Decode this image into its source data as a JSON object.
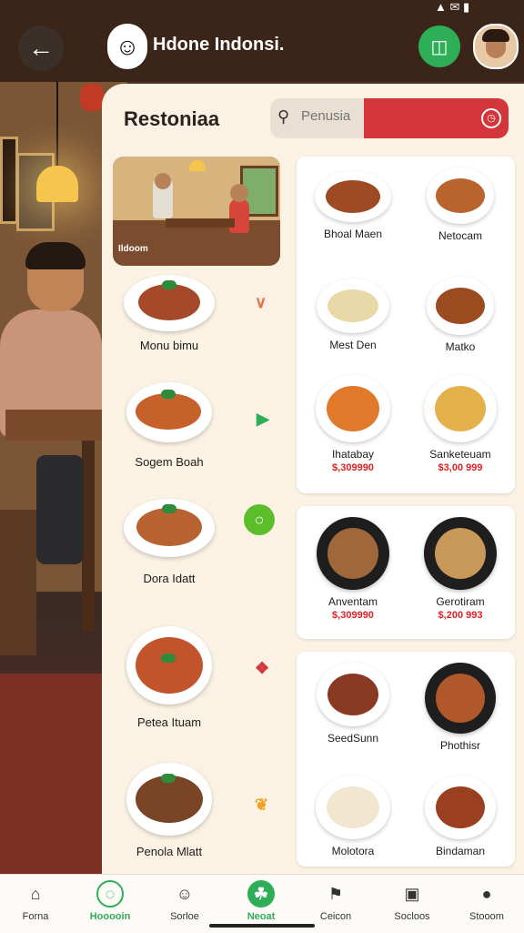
{
  "header": {
    "app_title": "Hdone Indonsi.",
    "status": "▲ ✉ ▮"
  },
  "panel": {
    "title": "Restoniaa",
    "search_placeholder": "Penusia",
    "hero_label": "Ildoom"
  },
  "left_dishes": [
    {
      "name": "Monu bimu",
      "mark": "∨",
      "mark_color": "#e8734a"
    },
    {
      "name": "Sogem Boah",
      "mark": "▶",
      "mark_color": "#2fae58"
    },
    {
      "name": "Dora Idatt",
      "mark": "○",
      "mark_color": "#5bbd2a"
    },
    {
      "name": "Petea Ituam",
      "mark": "❖",
      "mark_color": "#d2353a"
    },
    {
      "name": "Penola Mlatt",
      "mark": "❦",
      "mark_color": "#f2a024"
    }
  ],
  "right_cards": [
    {
      "items": [
        {
          "name": "Bhoal Maen",
          "price": ""
        },
        {
          "name": "Netocam",
          "price": ""
        },
        {
          "name": "Mest Den",
          "price": ""
        },
        {
          "name": "Matko",
          "price": ""
        },
        {
          "name": "Ihatabay",
          "price": "$,309990"
        },
        {
          "name": "Sanketeuam",
          "price": "$3,00 999"
        }
      ]
    },
    {
      "items": [
        {
          "name": "Anventam",
          "price": "$,309990"
        },
        {
          "name": "Gerotiram",
          "price": "$,200 993"
        }
      ]
    },
    {
      "items": [
        {
          "name": "SeedSunn",
          "price": ""
        },
        {
          "name": "Phothisr",
          "price": ""
        },
        {
          "name": "Molotora",
          "price": ""
        },
        {
          "name": "Bindaman",
          "price": ""
        }
      ]
    }
  ],
  "bottom_nav": [
    {
      "label": "Forna",
      "icon": "home-icon",
      "glyph": "⌂",
      "color": "#333",
      "active": false
    },
    {
      "label": "Hooooin",
      "icon": "chat-icon",
      "glyph": "◌",
      "color": "#2fae58",
      "active": true
    },
    {
      "label": "Sorloe",
      "icon": "smile-icon",
      "glyph": "☺",
      "color": "#333",
      "active": false
    },
    {
      "label": "Neoat",
      "icon": "leaf-icon",
      "glyph": "☘",
      "color": "#2fae58",
      "active": true
    },
    {
      "label": "Ceicon",
      "icon": "store-icon",
      "glyph": "⚑",
      "color": "#333",
      "active": false
    },
    {
      "label": "Socloos",
      "icon": "box-icon",
      "glyph": "▣",
      "color": "#333",
      "active": false
    },
    {
      "label": "Stooom",
      "icon": "profile-icon",
      "glyph": "●",
      "color": "#333",
      "active": false
    }
  ]
}
